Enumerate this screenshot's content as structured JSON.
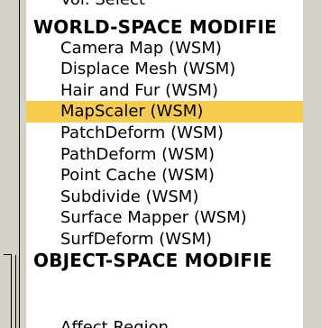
{
  "modifier_list": {
    "top_partial": "Vol. Select",
    "categories": [
      {
        "label": "WORLD-SPACE MODIFIE",
        "items": [
          {
            "label": "Camera Map (WSM)",
            "selected": false
          },
          {
            "label": "Displace Mesh (WSM)",
            "selected": false
          },
          {
            "label": "Hair and Fur (WSM)",
            "selected": false
          },
          {
            "label": "MapScaler (WSM)",
            "selected": true
          },
          {
            "label": "PatchDeform (WSM)",
            "selected": false
          },
          {
            "label": "PathDeform (WSM)",
            "selected": false
          },
          {
            "label": "Point Cache (WSM)",
            "selected": false
          },
          {
            "label": "Subdivide (WSM)",
            "selected": false
          },
          {
            "label": "Surface Mapper (WSM)",
            "selected": false
          },
          {
            "label": "SurfDeform (WSM)",
            "selected": false
          }
        ]
      },
      {
        "label": "OBJECT-SPACE MODIFIE",
        "items": []
      }
    ],
    "bottom_partial": "Affect Region",
    "selection_color": "#f5cc4d"
  }
}
